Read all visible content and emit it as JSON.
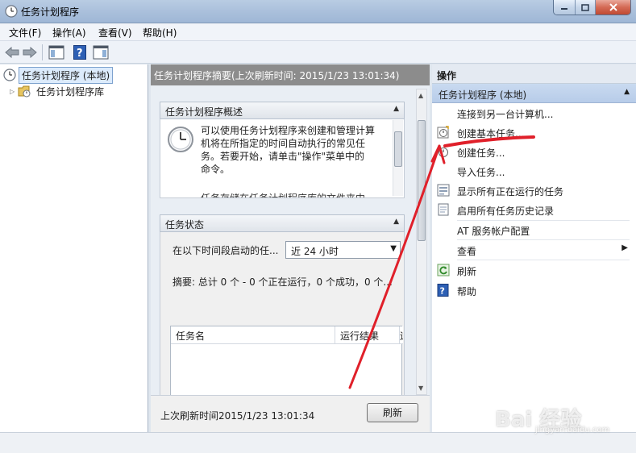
{
  "window": {
    "title": "任务计划程序"
  },
  "menu": {
    "items": [
      "文件(F)",
      "操作(A)",
      "查看(V)",
      "帮助(H)"
    ]
  },
  "tree": {
    "root": "任务计划程序 (本地)",
    "child": "任务计划程序库"
  },
  "center": {
    "header": "任务计划程序摘要(上次刷新时间: 2015/1/23 13:01:34)",
    "overview": {
      "title": "任务计划程序概述",
      "line1": "可以使用任务计划程序来创建和管理计算",
      "line2": "机将在所指定的时间自动执行的常见任",
      "line3": "务。若要开始，请单击\"操作\"菜单中的",
      "line4": "命令。",
      "line5": "任务存储在任务计划程序库的文件夹中"
    },
    "status": {
      "title": "任务状态",
      "period_label": "在以下时间段启动的任...",
      "period_value": "近 24 小时",
      "summary": "摘要: 总计 0 个 - 0 个正在运行，0 个成功，0 个...",
      "columns": [
        "任务名",
        "运行结果",
        "运"
      ]
    },
    "footer": {
      "last_refresh": "上次刷新时间2015/1/23 13:01:34",
      "refresh_button": "刷新"
    }
  },
  "actions": {
    "header": "操作",
    "group": "任务计划程序 (本地)",
    "items": [
      "连接到另一台计算机...",
      "创建基本任务...",
      "创建任务...",
      "导入任务...",
      "显示所有正在运行的任务",
      "启用所有任务历史记录",
      "AT 服务帐户配置",
      "查看",
      "刷新",
      "帮助"
    ]
  },
  "watermark": {
    "brand": "Bai 经验",
    "url": "jingyan.baidu.com"
  },
  "colors": {
    "annotation_red": "#e0202a",
    "selected_row": "#dcebfc",
    "center_header_bg": "#8c8c8c"
  }
}
